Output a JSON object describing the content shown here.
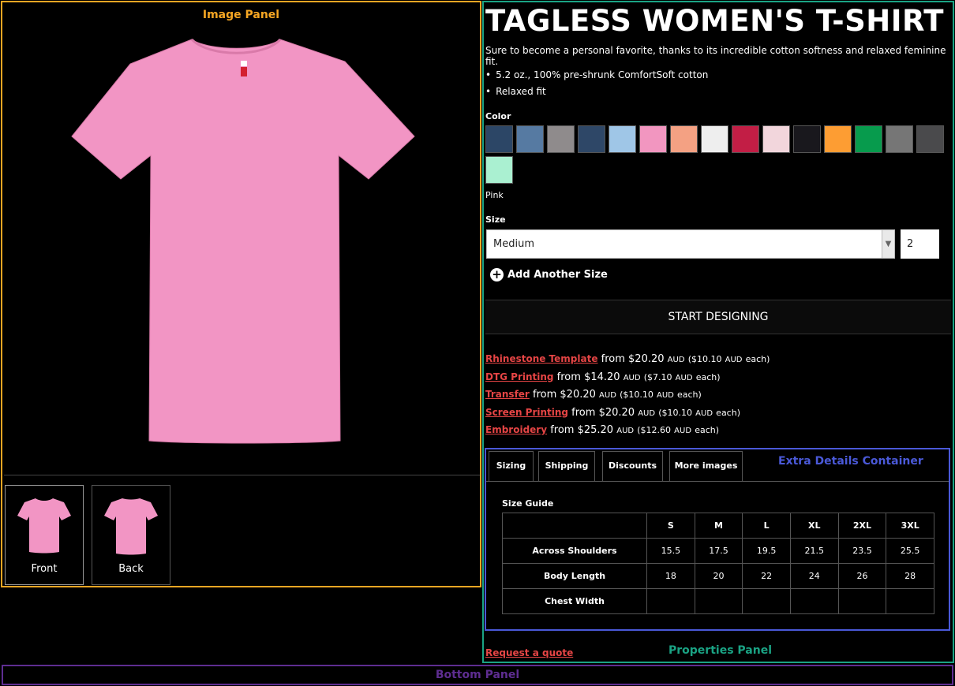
{
  "panels": {
    "image_panel_label": "Image Panel",
    "properties_panel_label": "Properties Panel",
    "extra_details_label": "Extra Details Container",
    "bottom_panel_label": "Bottom Panel"
  },
  "product": {
    "title": "TAGLESS WOMEN'S T-SHIRT",
    "description": "Sure to become a personal favorite, thanks to its incredible cotton softness and relaxed feminine fit.",
    "bullets": [
      "5.2 oz., 100% pre-shrunk ComfortSoft cotton",
      "Relaxed fit"
    ],
    "shirt_color": "#f295c4"
  },
  "thumbnails": [
    {
      "label": "Front"
    },
    {
      "label": "Back"
    }
  ],
  "color": {
    "label": "Color",
    "selected_name": "Pink",
    "swatches": [
      "#2c4666",
      "#567aa2",
      "#8f8b8c",
      "#2e4767",
      "#9fc6e7",
      "#f296c0",
      "#f4a183",
      "#eeeeee",
      "#c21e45",
      "#f2d6dc",
      "#19181d",
      "#fd9d33",
      "#079b4d",
      "#767676",
      "#4a4a4c",
      "#aaf0d1"
    ]
  },
  "size": {
    "label": "Size",
    "selected": "Medium",
    "quantity": "2",
    "add_another": "Add Another Size"
  },
  "start_button": "START DESIGNING",
  "pricing": [
    {
      "method": "Rhinestone Template",
      "from": "from",
      "price": "$20.20",
      "cur": "AUD",
      "each_open": "($10.10",
      "each_cur": "AUD",
      "each_close": "each)"
    },
    {
      "method": "DTG Printing",
      "from": "from",
      "price": "$14.20",
      "cur": "AUD",
      "each_open": "($7.10",
      "each_cur": "AUD",
      "each_close": "each)"
    },
    {
      "method": "Transfer",
      "from": "from",
      "price": "$20.20",
      "cur": "AUD",
      "each_open": "($10.10",
      "each_cur": "AUD",
      "each_close": "each)"
    },
    {
      "method": "Screen Printing",
      "from": "from",
      "price": "$20.20",
      "cur": "AUD",
      "each_open": "($10.10",
      "each_cur": "AUD",
      "each_close": "each)"
    },
    {
      "method": "Embroidery",
      "from": "from",
      "price": "$25.20",
      "cur": "AUD",
      "each_open": "($12.60",
      "each_cur": "AUD",
      "each_close": "each)"
    }
  ],
  "tabs": [
    "Sizing",
    "Shipping",
    "Discounts",
    "More images"
  ],
  "size_guide": {
    "title": "Size Guide",
    "columns": [
      "S",
      "M",
      "L",
      "XL",
      "2XL",
      "3XL"
    ],
    "rows": [
      {
        "label": "Across Shoulders",
        "values": [
          "15.5",
          "17.5",
          "19.5",
          "21.5",
          "23.5",
          "25.5"
        ]
      },
      {
        "label": "Body Length",
        "values": [
          "18",
          "20",
          "22",
          "24",
          "26",
          "28"
        ]
      },
      {
        "label": "Chest Width",
        "values": [
          "",
          "",
          "",
          "",
          "",
          ""
        ]
      }
    ]
  },
  "request_quote": "Request a quote"
}
